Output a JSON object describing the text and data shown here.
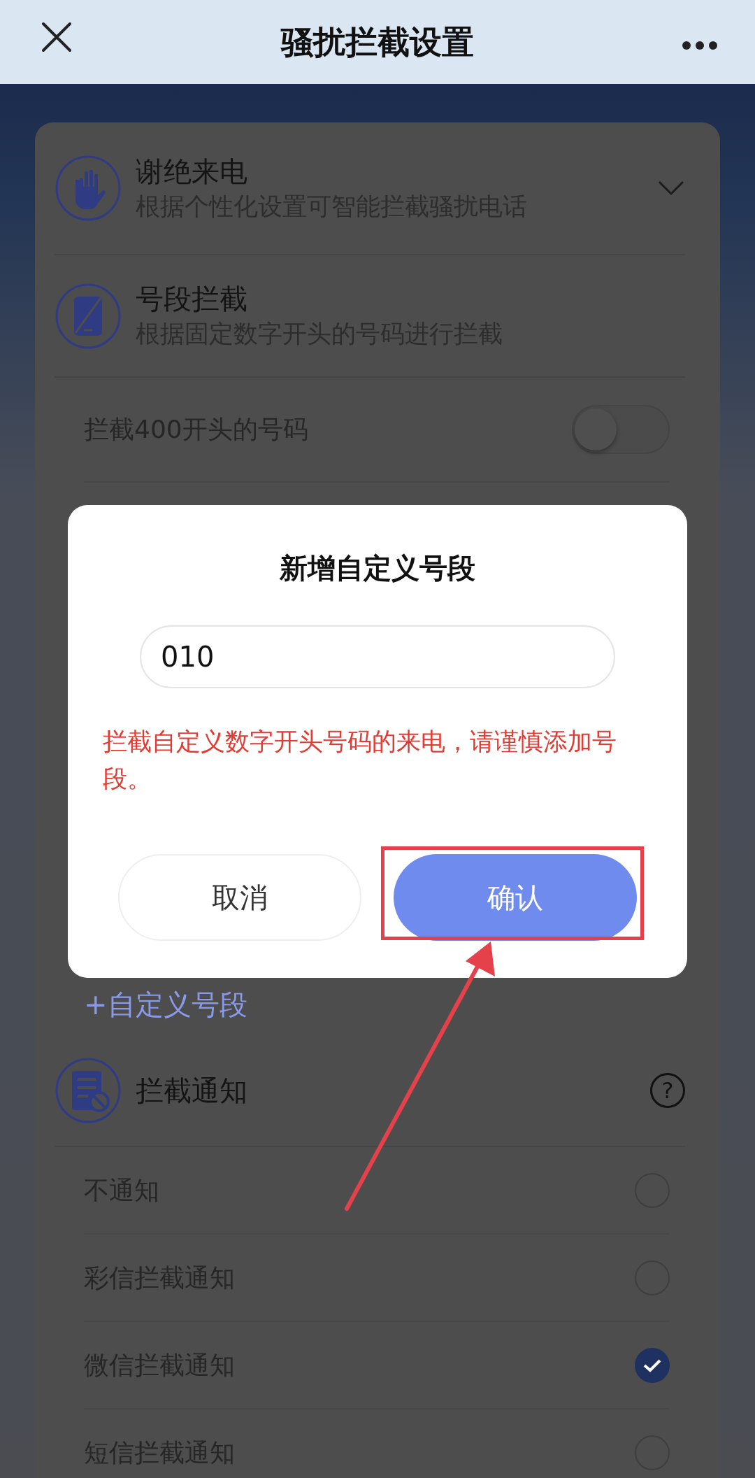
{
  "header": {
    "title": "骚扰拦截设置"
  },
  "decline_calls": {
    "title": "谢绝来电",
    "subtitle": "根据个性化设置可智能拦截骚扰电话",
    "expanded": false
  },
  "prefix_block": {
    "title": "号段拦截",
    "subtitle": "根据固定数字开头的号码进行拦截",
    "rules": [
      {
        "label": "拦截400开头的号码",
        "on": false
      }
    ],
    "add_link": "+自定义号段"
  },
  "notification": {
    "title": "拦截通知",
    "help": "?",
    "options": [
      {
        "label": "不通知",
        "selected": false
      },
      {
        "label": "彩信拦截通知",
        "selected": false
      },
      {
        "label": "微信拦截通知",
        "selected": true
      },
      {
        "label": "短信拦截通知",
        "selected": false
      }
    ]
  },
  "dialog": {
    "title": "新增自定义号段",
    "input": {
      "value": "010"
    },
    "warning": "拦截自定义数字开头号码的来电，请谨慎添加号段。",
    "buttons": [
      {
        "label": "取消",
        "kind": "secondary"
      },
      {
        "label": "确认",
        "kind": "primary"
      }
    ]
  }
}
